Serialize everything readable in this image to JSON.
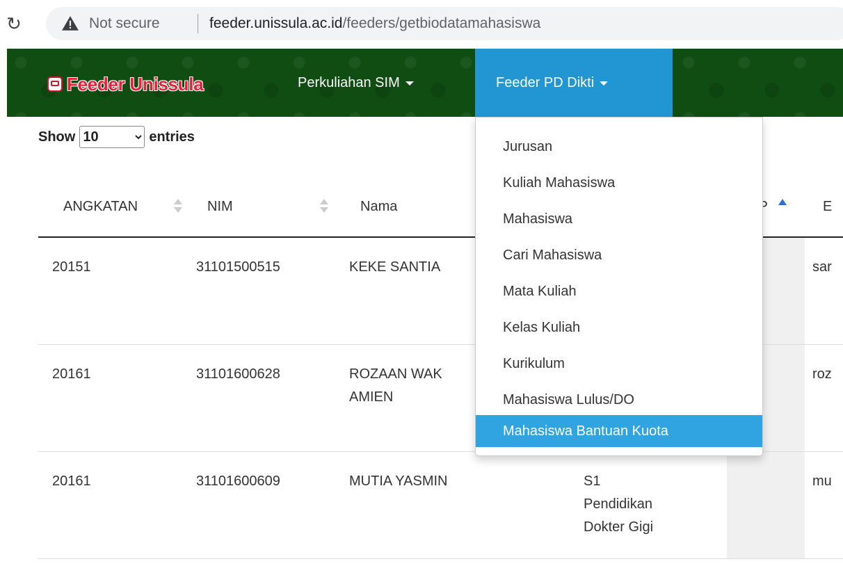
{
  "browser": {
    "reload_icon": "reload-icon",
    "security_label": "Not secure",
    "url_host": "feeder.unissula.ac.id",
    "url_path": "/feeders/getbiodatamahasiswa"
  },
  "navbar": {
    "brand": "Feeder Unissula",
    "menu": [
      {
        "label": "Perkuliahan SIM"
      },
      {
        "label": "Feeder PD Dikti"
      }
    ],
    "colors": {
      "bg": "#0f4d12",
      "active": "#2196d3",
      "brand": "#e8203a"
    }
  },
  "entries": {
    "show_label": "Show",
    "value": "10",
    "entries_label": "entries"
  },
  "table": {
    "columns": [
      "ANGKATAN",
      "NIM",
      "Nama",
      "IP",
      "E"
    ],
    "rows": [
      {
        "angkatan": "20151",
        "nim": "31101500515",
        "nama": "KEKE SANTIA",
        "prodi": "",
        "email": "sar"
      },
      {
        "angkatan": "20161",
        "nim": "31101600628",
        "nama_line1": "ROZAAN WAK",
        "nama_line2": "AMIEN",
        "prodi": "",
        "email": "roz"
      },
      {
        "angkatan": "20161",
        "nim": "31101600609",
        "nama": "MUTIA YASMIN",
        "prodi_line1": "S1",
        "prodi_line2": "Pendidikan",
        "prodi_line3": "Dokter Gigi",
        "email": "mu"
      }
    ]
  },
  "dropdown": {
    "items": [
      {
        "label": "Jurusan"
      },
      {
        "label": "Kuliah Mahasiswa"
      },
      {
        "label": "Mahasiswa"
      },
      {
        "label": "Cari Mahasiswa"
      },
      {
        "label": "Mata Kuliah"
      },
      {
        "label": "Kelas Kuliah"
      },
      {
        "label": "Kurikulum"
      },
      {
        "label": "Mahasiswa Lulus/DO"
      },
      {
        "label": "Mahasiswa Bantuan Kuota"
      }
    ],
    "active_color": "#30a4e0"
  }
}
